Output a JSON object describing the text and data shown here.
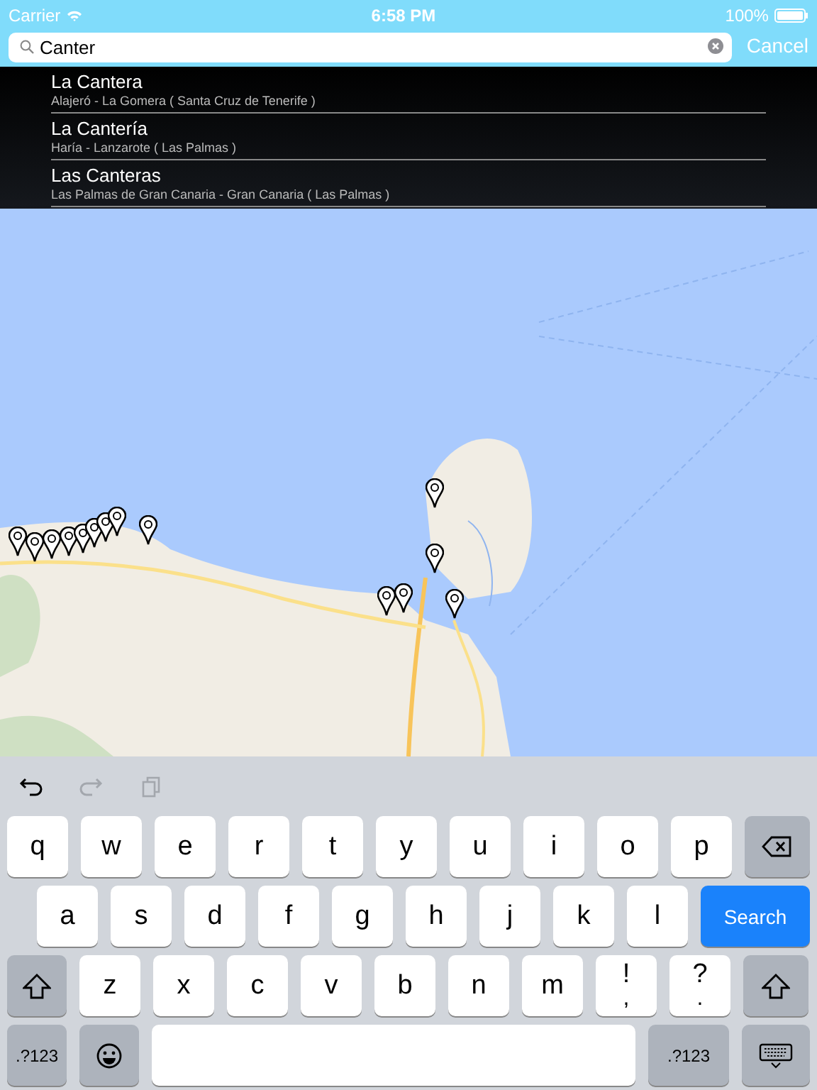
{
  "status_bar": {
    "carrier": "Carrier",
    "time": "6:58 PM",
    "battery": "100%"
  },
  "search": {
    "value": "Canter",
    "cancel": "Cancel"
  },
  "suggestions": [
    {
      "title": "La Cantera",
      "subtitle": "Alajeró - La Gomera ( Santa Cruz de Tenerife )"
    },
    {
      "title": "La Cantería",
      "subtitle": "Haría - Lanzarote ( Las Palmas )"
    },
    {
      "title": "Las Canteras",
      "subtitle": "Las Palmas de Gran Canaria - Gran Canaria ( Las Palmas )"
    }
  ],
  "keyboard": {
    "toolbar": [
      {
        "kind": "undo",
        "disabled": false
      },
      {
        "kind": "redo",
        "disabled": true
      },
      {
        "kind": "paste",
        "disabled": true
      }
    ],
    "rows": [
      {
        "keys": [
          {
            "kind": "letter",
            "label": "q"
          },
          {
            "kind": "letter",
            "label": "w"
          },
          {
            "kind": "letter",
            "label": "e"
          },
          {
            "kind": "letter",
            "label": "r"
          },
          {
            "kind": "letter",
            "label": "t"
          },
          {
            "kind": "letter",
            "label": "y"
          },
          {
            "kind": "letter",
            "label": "u"
          },
          {
            "kind": "letter",
            "label": "i"
          },
          {
            "kind": "letter",
            "label": "o"
          },
          {
            "kind": "letter",
            "label": "p"
          },
          {
            "kind": "backspace"
          }
        ]
      },
      {
        "keys": [
          {
            "kind": "letter",
            "label": "a"
          },
          {
            "kind": "letter",
            "label": "s"
          },
          {
            "kind": "letter",
            "label": "d"
          },
          {
            "kind": "letter",
            "label": "f"
          },
          {
            "kind": "letter",
            "label": "g"
          },
          {
            "kind": "letter",
            "label": "h"
          },
          {
            "kind": "letter",
            "label": "j"
          },
          {
            "kind": "letter",
            "label": "k"
          },
          {
            "kind": "letter",
            "label": "l"
          },
          {
            "kind": "action",
            "label": "Search"
          }
        ]
      },
      {
        "keys": [
          {
            "kind": "shift"
          },
          {
            "kind": "letter",
            "label": "z"
          },
          {
            "kind": "letter",
            "label": "x"
          },
          {
            "kind": "letter",
            "label": "c"
          },
          {
            "kind": "letter",
            "label": "v"
          },
          {
            "kind": "letter",
            "label": "b"
          },
          {
            "kind": "letter",
            "label": "n"
          },
          {
            "kind": "letter",
            "label": "m"
          },
          {
            "kind": "dual",
            "label": "!",
            "sub": ","
          },
          {
            "kind": "dual",
            "label": "?",
            "sub": "."
          },
          {
            "kind": "shift"
          }
        ]
      },
      {
        "keys": [
          {
            "kind": "mode",
            "label": ".?123"
          },
          {
            "kind": "emoji"
          },
          {
            "kind": "space"
          },
          {
            "kind": "mode",
            "label": ".?123"
          },
          {
            "kind": "hide"
          }
        ]
      }
    ]
  }
}
